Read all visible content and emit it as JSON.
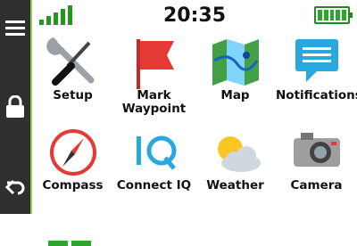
{
  "status": {
    "time": "20:35",
    "signal_bars": 4,
    "battery_level": 1.0
  },
  "sidebar": {
    "items": [
      {
        "name": "menu-icon"
      },
      {
        "name": "lock-icon"
      },
      {
        "name": "back-icon"
      }
    ]
  },
  "apps": [
    {
      "label": "Setup",
      "icon": "wrench-screwdriver-icon"
    },
    {
      "label": "Mark\nWaypoint",
      "icon": "flag-icon"
    },
    {
      "label": "Map",
      "icon": "map-icon"
    },
    {
      "label": "Notifications",
      "icon": "chat-bubble-icon"
    },
    {
      "label": "Compass",
      "icon": "compass-icon"
    },
    {
      "label": "Connect IQ",
      "icon": "connect-iq-icon"
    },
    {
      "label": "Weather",
      "icon": "weather-icon"
    },
    {
      "label": "Camera",
      "icon": "camera-icon"
    }
  ],
  "colors": {
    "accent": "#8fd14f",
    "sidebar_bg": "#2f2f2f",
    "status_green": "#1f9a1f"
  }
}
